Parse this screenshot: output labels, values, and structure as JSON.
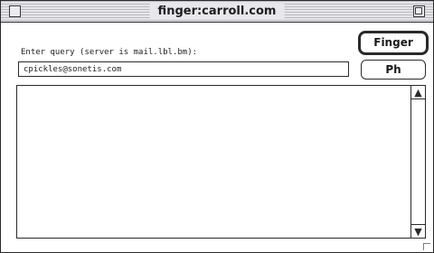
{
  "window": {
    "title": "finger:carroll.com"
  },
  "form": {
    "prompt": "Enter query (server is mail.lbl.bm):",
    "query_value": "cpickles@sonetis.com"
  },
  "buttons": {
    "finger_label": "Finger",
    "ph_label": "Ph"
  },
  "scrollbar": {
    "up_icon": "up-arrow-icon",
    "down_icon": "down-arrow-icon"
  }
}
